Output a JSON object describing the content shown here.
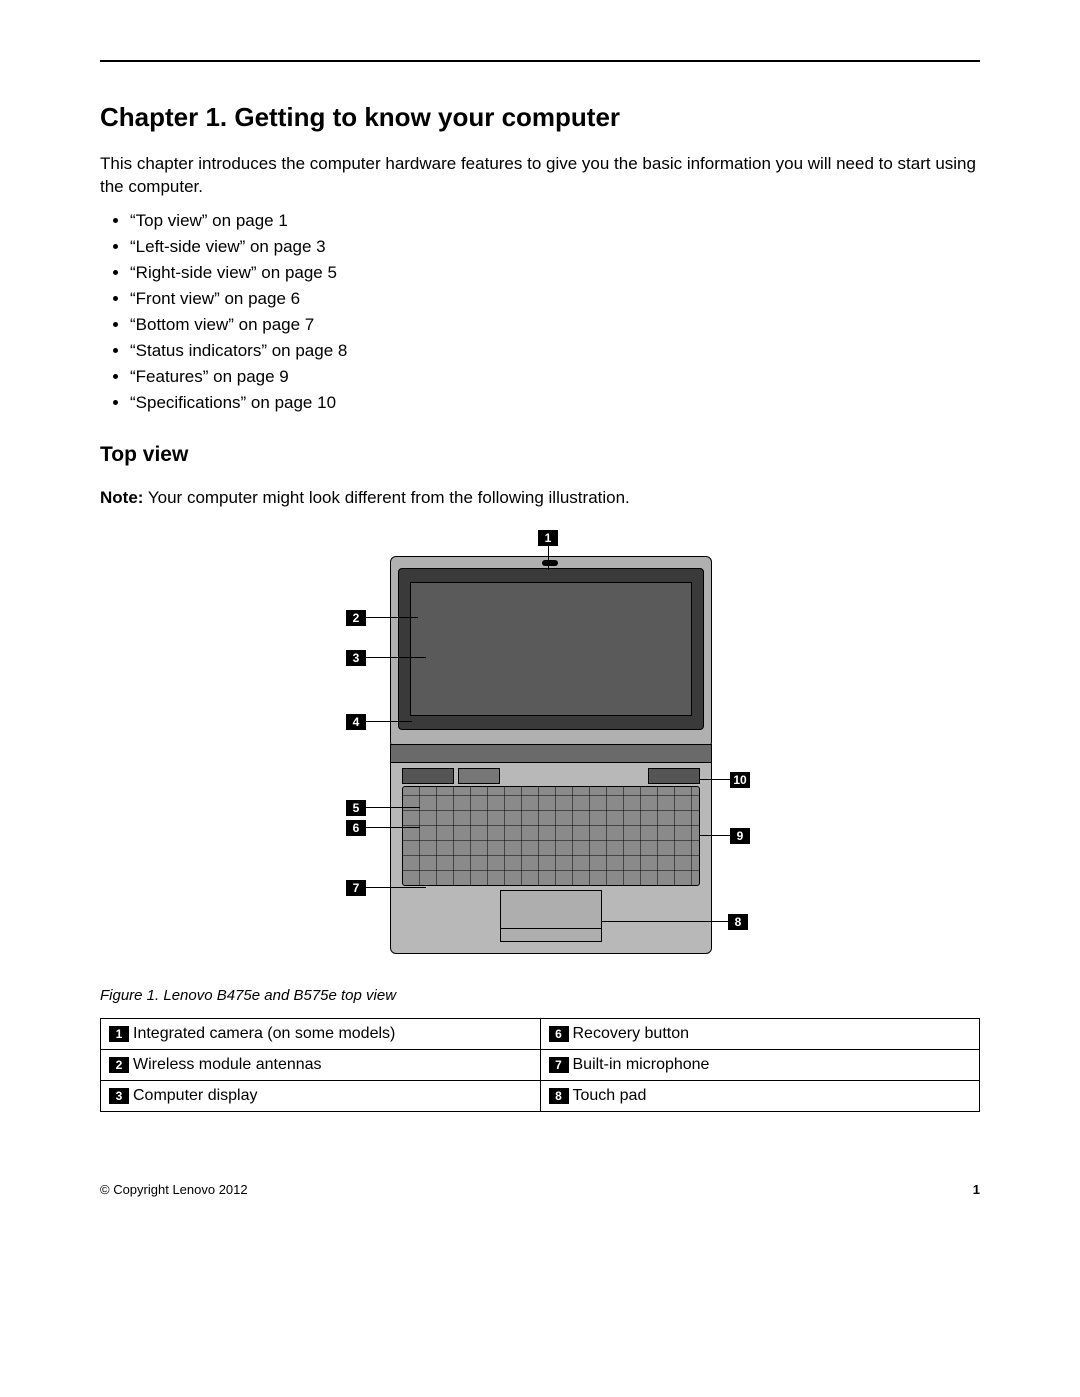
{
  "chapter_title": "Chapter 1.  Getting to know your computer",
  "intro": "This chapter introduces the computer hardware features to give you the basic information you will need to start using the computer.",
  "toc": [
    "“Top view” on page 1",
    "“Left-side view” on page 3",
    "“Right-side view” on page 5",
    "“Front view” on page 6",
    "“Bottom view” on page 7",
    "“Status indicators” on page 8",
    "“Features” on page 9",
    "“Specifications” on page 10"
  ],
  "section_heading": "Top view",
  "note_label": "Note:",
  "note_text": " Your computer might look different from the following illustration.",
  "figure_caption": "Figure 1.  Lenovo B475e and B575e top view",
  "callouts": {
    "n1": "1",
    "n2": "2",
    "n3": "3",
    "n4": "4",
    "n5": "5",
    "n6": "6",
    "n7": "7",
    "n8": "8",
    "n9": "9",
    "n10": "10"
  },
  "legend": [
    {
      "num": "1",
      "text": "Integrated camera (on some models)"
    },
    {
      "num": "2",
      "text": "Wireless module antennas"
    },
    {
      "num": "3",
      "text": "Computer display"
    },
    {
      "num": "6",
      "text": "Recovery button"
    },
    {
      "num": "7",
      "text": "Built-in microphone"
    },
    {
      "num": "8",
      "text": "Touch pad"
    }
  ],
  "footer": {
    "copyright": "© Copyright Lenovo 2012",
    "page": "1"
  }
}
